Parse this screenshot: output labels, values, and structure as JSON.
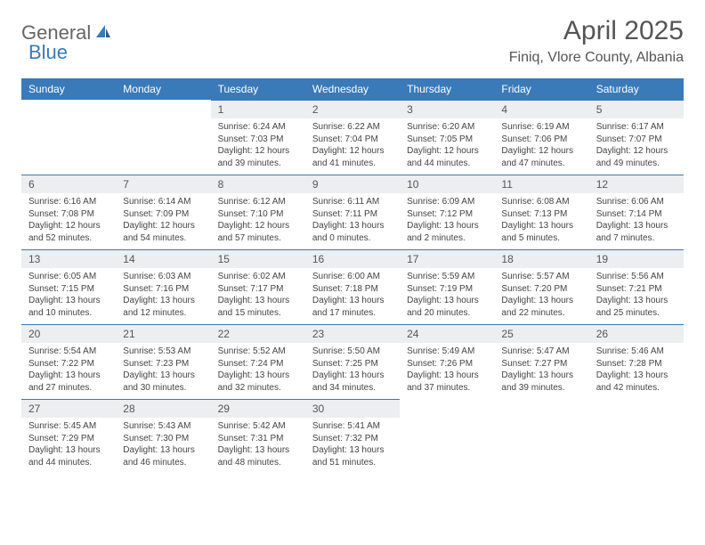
{
  "brand": {
    "part1": "General",
    "part2": "Blue"
  },
  "title": "April 2025",
  "location": "Finiq, Vlore County, Albania",
  "weekdays": [
    "Sunday",
    "Monday",
    "Tuesday",
    "Wednesday",
    "Thursday",
    "Friday",
    "Saturday"
  ],
  "days": [
    {
      "n": "",
      "sunrise": "",
      "sunset": "",
      "daylight": ""
    },
    {
      "n": "",
      "sunrise": "",
      "sunset": "",
      "daylight": ""
    },
    {
      "n": "1",
      "sunrise": "Sunrise: 6:24 AM",
      "sunset": "Sunset: 7:03 PM",
      "daylight": "Daylight: 12 hours and 39 minutes."
    },
    {
      "n": "2",
      "sunrise": "Sunrise: 6:22 AM",
      "sunset": "Sunset: 7:04 PM",
      "daylight": "Daylight: 12 hours and 41 minutes."
    },
    {
      "n": "3",
      "sunrise": "Sunrise: 6:20 AM",
      "sunset": "Sunset: 7:05 PM",
      "daylight": "Daylight: 12 hours and 44 minutes."
    },
    {
      "n": "4",
      "sunrise": "Sunrise: 6:19 AM",
      "sunset": "Sunset: 7:06 PM",
      "daylight": "Daylight: 12 hours and 47 minutes."
    },
    {
      "n": "5",
      "sunrise": "Sunrise: 6:17 AM",
      "sunset": "Sunset: 7:07 PM",
      "daylight": "Daylight: 12 hours and 49 minutes."
    },
    {
      "n": "6",
      "sunrise": "Sunrise: 6:16 AM",
      "sunset": "Sunset: 7:08 PM",
      "daylight": "Daylight: 12 hours and 52 minutes."
    },
    {
      "n": "7",
      "sunrise": "Sunrise: 6:14 AM",
      "sunset": "Sunset: 7:09 PM",
      "daylight": "Daylight: 12 hours and 54 minutes."
    },
    {
      "n": "8",
      "sunrise": "Sunrise: 6:12 AM",
      "sunset": "Sunset: 7:10 PM",
      "daylight": "Daylight: 12 hours and 57 minutes."
    },
    {
      "n": "9",
      "sunrise": "Sunrise: 6:11 AM",
      "sunset": "Sunset: 7:11 PM",
      "daylight": "Daylight: 13 hours and 0 minutes."
    },
    {
      "n": "10",
      "sunrise": "Sunrise: 6:09 AM",
      "sunset": "Sunset: 7:12 PM",
      "daylight": "Daylight: 13 hours and 2 minutes."
    },
    {
      "n": "11",
      "sunrise": "Sunrise: 6:08 AM",
      "sunset": "Sunset: 7:13 PM",
      "daylight": "Daylight: 13 hours and 5 minutes."
    },
    {
      "n": "12",
      "sunrise": "Sunrise: 6:06 AM",
      "sunset": "Sunset: 7:14 PM",
      "daylight": "Daylight: 13 hours and 7 minutes."
    },
    {
      "n": "13",
      "sunrise": "Sunrise: 6:05 AM",
      "sunset": "Sunset: 7:15 PM",
      "daylight": "Daylight: 13 hours and 10 minutes."
    },
    {
      "n": "14",
      "sunrise": "Sunrise: 6:03 AM",
      "sunset": "Sunset: 7:16 PM",
      "daylight": "Daylight: 13 hours and 12 minutes."
    },
    {
      "n": "15",
      "sunrise": "Sunrise: 6:02 AM",
      "sunset": "Sunset: 7:17 PM",
      "daylight": "Daylight: 13 hours and 15 minutes."
    },
    {
      "n": "16",
      "sunrise": "Sunrise: 6:00 AM",
      "sunset": "Sunset: 7:18 PM",
      "daylight": "Daylight: 13 hours and 17 minutes."
    },
    {
      "n": "17",
      "sunrise": "Sunrise: 5:59 AM",
      "sunset": "Sunset: 7:19 PM",
      "daylight": "Daylight: 13 hours and 20 minutes."
    },
    {
      "n": "18",
      "sunrise": "Sunrise: 5:57 AM",
      "sunset": "Sunset: 7:20 PM",
      "daylight": "Daylight: 13 hours and 22 minutes."
    },
    {
      "n": "19",
      "sunrise": "Sunrise: 5:56 AM",
      "sunset": "Sunset: 7:21 PM",
      "daylight": "Daylight: 13 hours and 25 minutes."
    },
    {
      "n": "20",
      "sunrise": "Sunrise: 5:54 AM",
      "sunset": "Sunset: 7:22 PM",
      "daylight": "Daylight: 13 hours and 27 minutes."
    },
    {
      "n": "21",
      "sunrise": "Sunrise: 5:53 AM",
      "sunset": "Sunset: 7:23 PM",
      "daylight": "Daylight: 13 hours and 30 minutes."
    },
    {
      "n": "22",
      "sunrise": "Sunrise: 5:52 AM",
      "sunset": "Sunset: 7:24 PM",
      "daylight": "Daylight: 13 hours and 32 minutes."
    },
    {
      "n": "23",
      "sunrise": "Sunrise: 5:50 AM",
      "sunset": "Sunset: 7:25 PM",
      "daylight": "Daylight: 13 hours and 34 minutes."
    },
    {
      "n": "24",
      "sunrise": "Sunrise: 5:49 AM",
      "sunset": "Sunset: 7:26 PM",
      "daylight": "Daylight: 13 hours and 37 minutes."
    },
    {
      "n": "25",
      "sunrise": "Sunrise: 5:47 AM",
      "sunset": "Sunset: 7:27 PM",
      "daylight": "Daylight: 13 hours and 39 minutes."
    },
    {
      "n": "26",
      "sunrise": "Sunrise: 5:46 AM",
      "sunset": "Sunset: 7:28 PM",
      "daylight": "Daylight: 13 hours and 42 minutes."
    },
    {
      "n": "27",
      "sunrise": "Sunrise: 5:45 AM",
      "sunset": "Sunset: 7:29 PM",
      "daylight": "Daylight: 13 hours and 44 minutes."
    },
    {
      "n": "28",
      "sunrise": "Sunrise: 5:43 AM",
      "sunset": "Sunset: 7:30 PM",
      "daylight": "Daylight: 13 hours and 46 minutes."
    },
    {
      "n": "29",
      "sunrise": "Sunrise: 5:42 AM",
      "sunset": "Sunset: 7:31 PM",
      "daylight": "Daylight: 13 hours and 48 minutes."
    },
    {
      "n": "30",
      "sunrise": "Sunrise: 5:41 AM",
      "sunset": "Sunset: 7:32 PM",
      "daylight": "Daylight: 13 hours and 51 minutes."
    },
    {
      "n": "",
      "sunrise": "",
      "sunset": "",
      "daylight": ""
    },
    {
      "n": "",
      "sunrise": "",
      "sunset": "",
      "daylight": ""
    },
    {
      "n": "",
      "sunrise": "",
      "sunset": "",
      "daylight": ""
    }
  ]
}
